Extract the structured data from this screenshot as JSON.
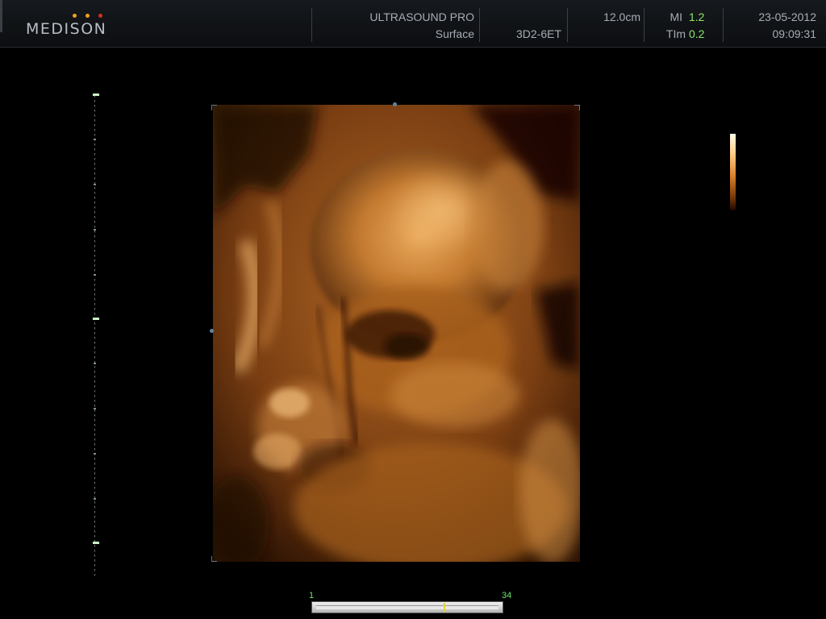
{
  "brand": {
    "name": "MEDISON",
    "dot_colors": [
      "#f0a21e",
      "#f0a21e",
      "#d6301c"
    ]
  },
  "header": {
    "system": "ULTRASOUND PRO",
    "mode": "Surface",
    "probe": "3D2-6ET",
    "depth": "12.0cm",
    "mi_label": "MI",
    "mi_value": "1.2",
    "ti_label": "TIm",
    "ti_value": "0.2",
    "date": "23-05-2012",
    "time": "09:09:31"
  },
  "cine": {
    "start": "1",
    "end": "34",
    "current_fraction": 0.69
  },
  "colors": {
    "background": "#000000",
    "accent_green": "#8ee66a",
    "tint": "#d9822b"
  }
}
